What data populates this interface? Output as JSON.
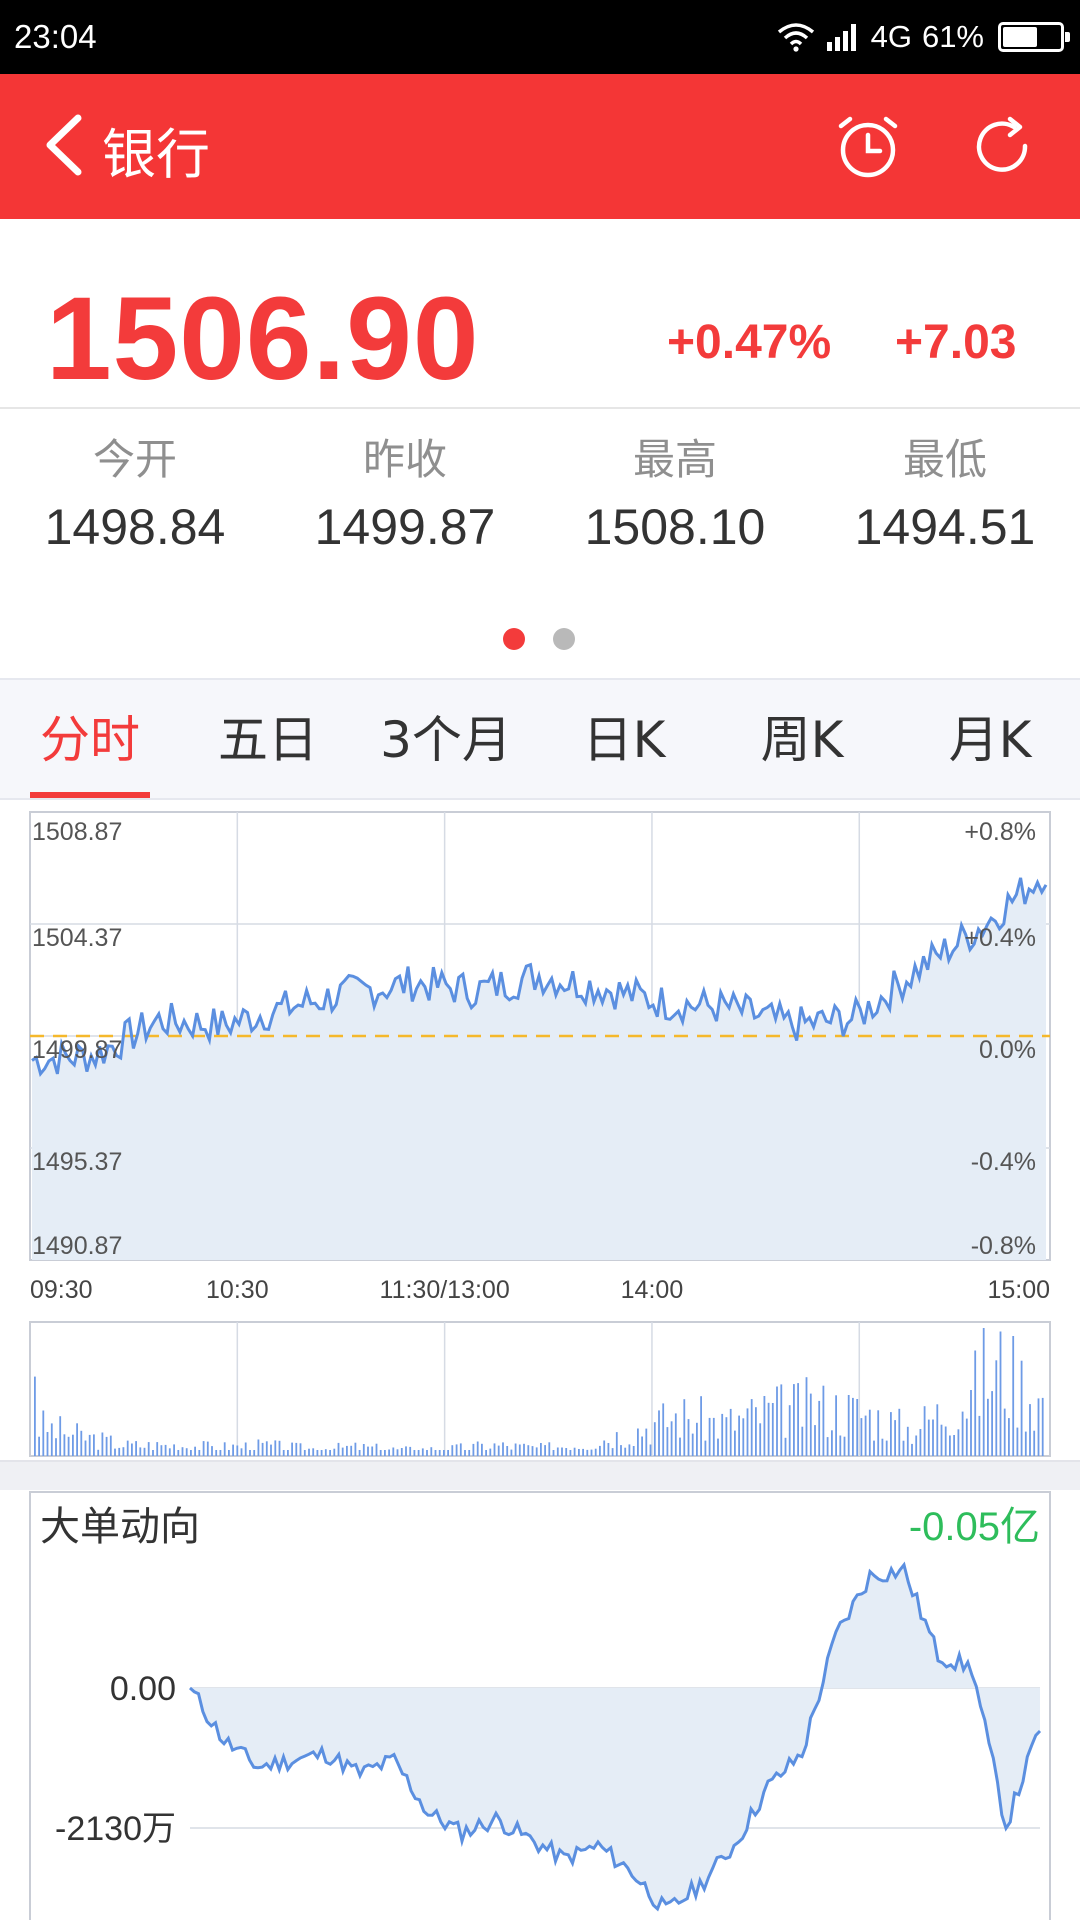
{
  "status": {
    "time": "23:04",
    "network": "4G",
    "battery": "61%",
    "battery_level": 0.61
  },
  "header": {
    "title": "银行"
  },
  "quote": {
    "price": "1506.90",
    "change_pct": "+0.47%",
    "change": "+7.03"
  },
  "stats": [
    {
      "label": "今开",
      "value": "1498.84"
    },
    {
      "label": "昨收",
      "value": "1499.87"
    },
    {
      "label": "最高",
      "value": "1508.10"
    },
    {
      "label": "最低",
      "value": "1494.51"
    }
  ],
  "pager": {
    "count": 2,
    "active": 0
  },
  "tabs": [
    {
      "label": "分时",
      "active": true
    },
    {
      "label": "五日",
      "active": false
    },
    {
      "label": "3个月",
      "active": false
    },
    {
      "label": "日K",
      "active": false
    },
    {
      "label": "周K",
      "active": false
    },
    {
      "label": "月K",
      "active": false
    }
  ],
  "colors": {
    "brand": "#f43636",
    "up": "#f33b3b",
    "down": "#2ebd5b",
    "line": "#5b8fe0",
    "fill": "#e5edf6",
    "baseline": "#f5b82b"
  },
  "chart_data": [
    {
      "type": "line",
      "price_labels": [
        "1508.87",
        "1504.37",
        "1499.87",
        "1495.37",
        "1490.87"
      ],
      "pct_labels": [
        "+0.8%",
        "+0.4%",
        "0.0%",
        "-0.4%",
        "-0.8%"
      ],
      "time_labels": [
        "09:30",
        "10:30",
        "11:30/13:00",
        "14:00",
        "15:00"
      ],
      "ylim": [
        1490.87,
        1508.87
      ],
      "baseline": 1499.87,
      "x": [
        "09:30",
        "09:45",
        "10:00",
        "10:15",
        "10:30",
        "10:45",
        "11:00",
        "11:15",
        "11:30/13:00",
        "13:15",
        "13:30",
        "13:45",
        "14:00",
        "14:15",
        "14:30",
        "14:45",
        "15:00"
      ],
      "values": [
        1498.9,
        1499.1,
        1500.5,
        1500.3,
        1501.0,
        1501.6,
        1502.0,
        1501.7,
        1502.3,
        1501.8,
        1501.2,
        1501.0,
        1500.3,
        1500.6,
        1502.6,
        1504.3,
        1506.5
      ]
    },
    {
      "type": "bar",
      "x": [
        "09:30",
        "10:30",
        "11:30/13:00",
        "14:00",
        "15:00"
      ],
      "values_relative": [
        0.35,
        0.22,
        0.12,
        0.12,
        0.1,
        0.12,
        0.08,
        0.1,
        0.07,
        0.08,
        0.12,
        0.09,
        0.14,
        0.28,
        0.45,
        0.36,
        0.5,
        0.55,
        0.48,
        0.3,
        0.56,
        1.0,
        0.55
      ]
    },
    {
      "type": "area",
      "title": "大单动向",
      "total": "-0.05亿",
      "y_labels": [
        "0.00",
        "-2130万"
      ],
      "values": [
        0,
        -800,
        -1200,
        -1100,
        -1000,
        -1300,
        -1100,
        -1900,
        -2200,
        -2000,
        -2300,
        -2600,
        -2400,
        -2800,
        -3400,
        -3000,
        -2400,
        -1500,
        -1000,
        800,
        1700,
        1800,
        500,
        300,
        -2100,
        -600
      ]
    }
  ]
}
